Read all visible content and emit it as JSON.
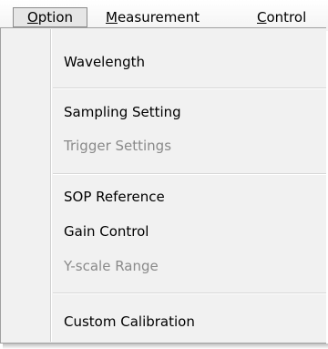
{
  "menubar": {
    "option": {
      "first": "O",
      "rest": "ption"
    },
    "measurement": {
      "first": "M",
      "rest": "easurement"
    },
    "control": {
      "first": "C",
      "rest": "ontrol"
    }
  },
  "dropdown": {
    "items": [
      {
        "label": "Wavelength",
        "enabled": true
      },
      {
        "label": "Sampling Setting",
        "enabled": true
      },
      {
        "label": "Trigger Settings",
        "enabled": false
      },
      {
        "label": "SOP Reference",
        "enabled": true
      },
      {
        "label": "Gain Control",
        "enabled": true
      },
      {
        "label": "Y-scale Range",
        "enabled": false
      },
      {
        "label": "Custom Calibration",
        "enabled": true
      }
    ]
  }
}
